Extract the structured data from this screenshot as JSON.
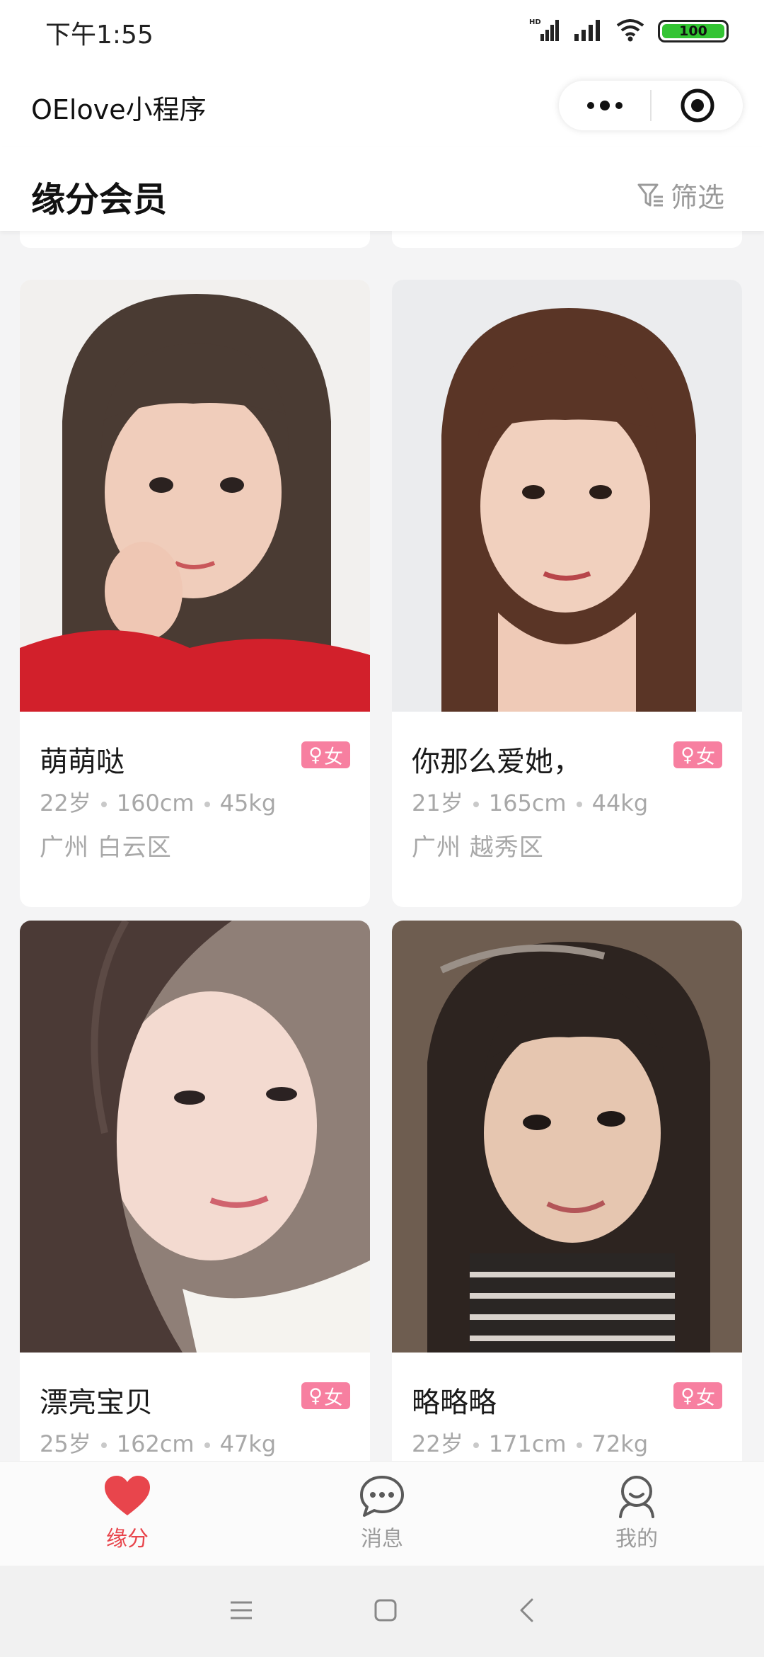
{
  "status_bar": {
    "time": "下午1:55",
    "network_label": "HD",
    "battery_level": "100"
  },
  "app": {
    "title": "OElove小程序"
  },
  "header": {
    "title": "缘分会员",
    "filter_label": "筛选"
  },
  "members": [
    {
      "name": "萌萌哒",
      "gender": "女",
      "age": "22岁",
      "height": "160cm",
      "weight": "45kg",
      "location": "广州 白云区"
    },
    {
      "name": "你那么爱她，",
      "gender": "女",
      "age": "21岁",
      "height": "165cm",
      "weight": "44kg",
      "location": "广州 越秀区"
    },
    {
      "name": "漂亮宝贝",
      "gender": "女",
      "age": "25岁",
      "height": "162cm",
      "weight": "47kg",
      "location": ""
    },
    {
      "name": "略略略",
      "gender": "女",
      "age": "22岁",
      "height": "171cm",
      "weight": "72kg",
      "location": ""
    }
  ],
  "tabs": [
    {
      "label": "缘分",
      "icon": "heart-icon",
      "active": true
    },
    {
      "label": "消息",
      "icon": "chat-icon",
      "active": false
    },
    {
      "label": "我的",
      "icon": "user-icon",
      "active": false
    }
  ],
  "colors": {
    "accent": "#e8454c",
    "gender_badge": "#f77fa0",
    "inactive": "#9b9b9b"
  }
}
